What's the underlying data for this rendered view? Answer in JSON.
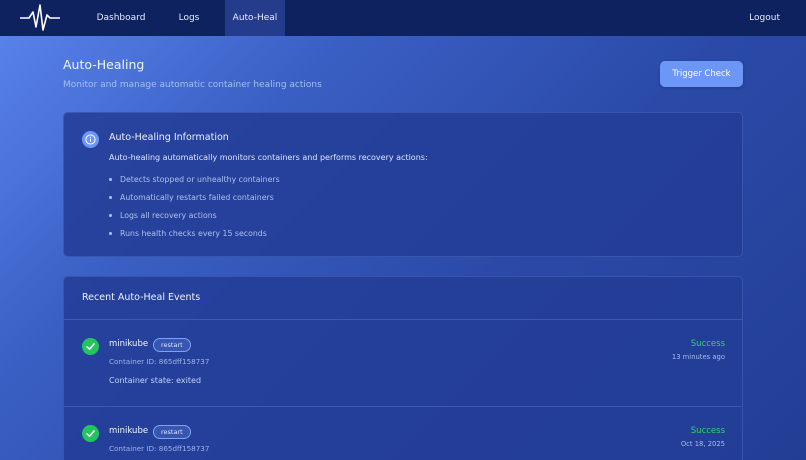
{
  "nav": {
    "links": [
      {
        "label": "Dashboard"
      },
      {
        "label": "Logs"
      },
      {
        "label": "Auto-Heal"
      }
    ],
    "logout": "Logout"
  },
  "header": {
    "title": "Auto-Healing",
    "subtitle": "Monitor and manage automatic container healing actions",
    "trigger_button": "Trigger Check"
  },
  "info": {
    "icon": "info-icon",
    "title": "Auto-Healing Information",
    "description": "Auto-healing automatically monitors containers and performs recovery actions:",
    "items": [
      "Detects stopped or unhealthy containers",
      "Automatically restarts failed containers",
      "Logs all recovery actions",
      "Runs health checks every 15 seconds"
    ]
  },
  "events": {
    "title": "Recent Auto-Heal Events",
    "list": [
      {
        "name": "minikube",
        "action": "restart",
        "container_id": "Container ID: 865dff158737",
        "state": "Container state: exited",
        "status": "Success",
        "time": "13 minutes ago"
      },
      {
        "name": "minikube",
        "action": "restart",
        "container_id": "Container ID: 865dff158737",
        "state": "",
        "status": "Success",
        "time": "Oct 18, 2025"
      }
    ]
  },
  "colors": {
    "navbar": "#0e2260",
    "accent": "#6d97f6",
    "success": "#22c55e"
  }
}
